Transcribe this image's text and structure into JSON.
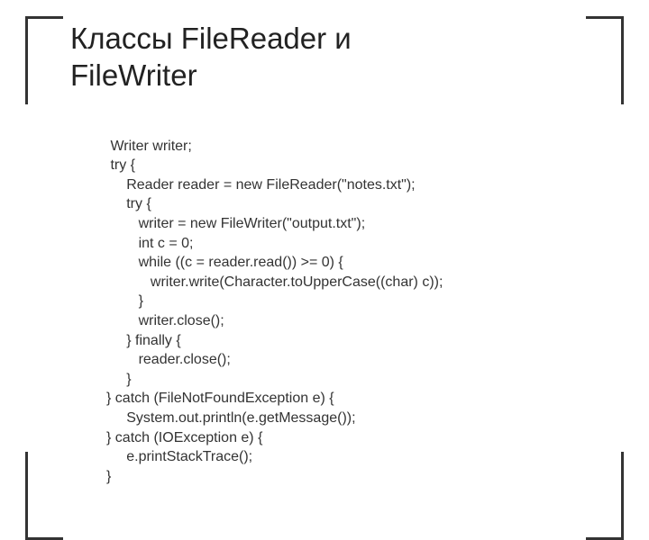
{
  "title_line1": "Классы FileReader и",
  "title_line2": "FileWriter",
  "code": {
    "l1": " Writer writer;",
    "l2": " try {",
    "l3": "     Reader reader = new FileReader(\"notes.txt\");",
    "l4": "     try {",
    "l5": "        writer = new FileWriter(\"output.txt\");",
    "l6": "        int c = 0;",
    "l7": "        while ((c = reader.read()) >= 0) {",
    "l8": "           writer.write(Character.toUpperCase((char) c));",
    "l9": "        }",
    "l10": "        writer.close();",
    "l11": "     } finally {",
    "l12": "        reader.close();",
    "l13": "     }",
    "l14": "} catch (FileNotFoundException e) {",
    "l15": "     System.out.println(e.getMessage());",
    "l16": "} catch (IOException e) {",
    "l17": "     e.printStackTrace();",
    "l18": "}"
  }
}
